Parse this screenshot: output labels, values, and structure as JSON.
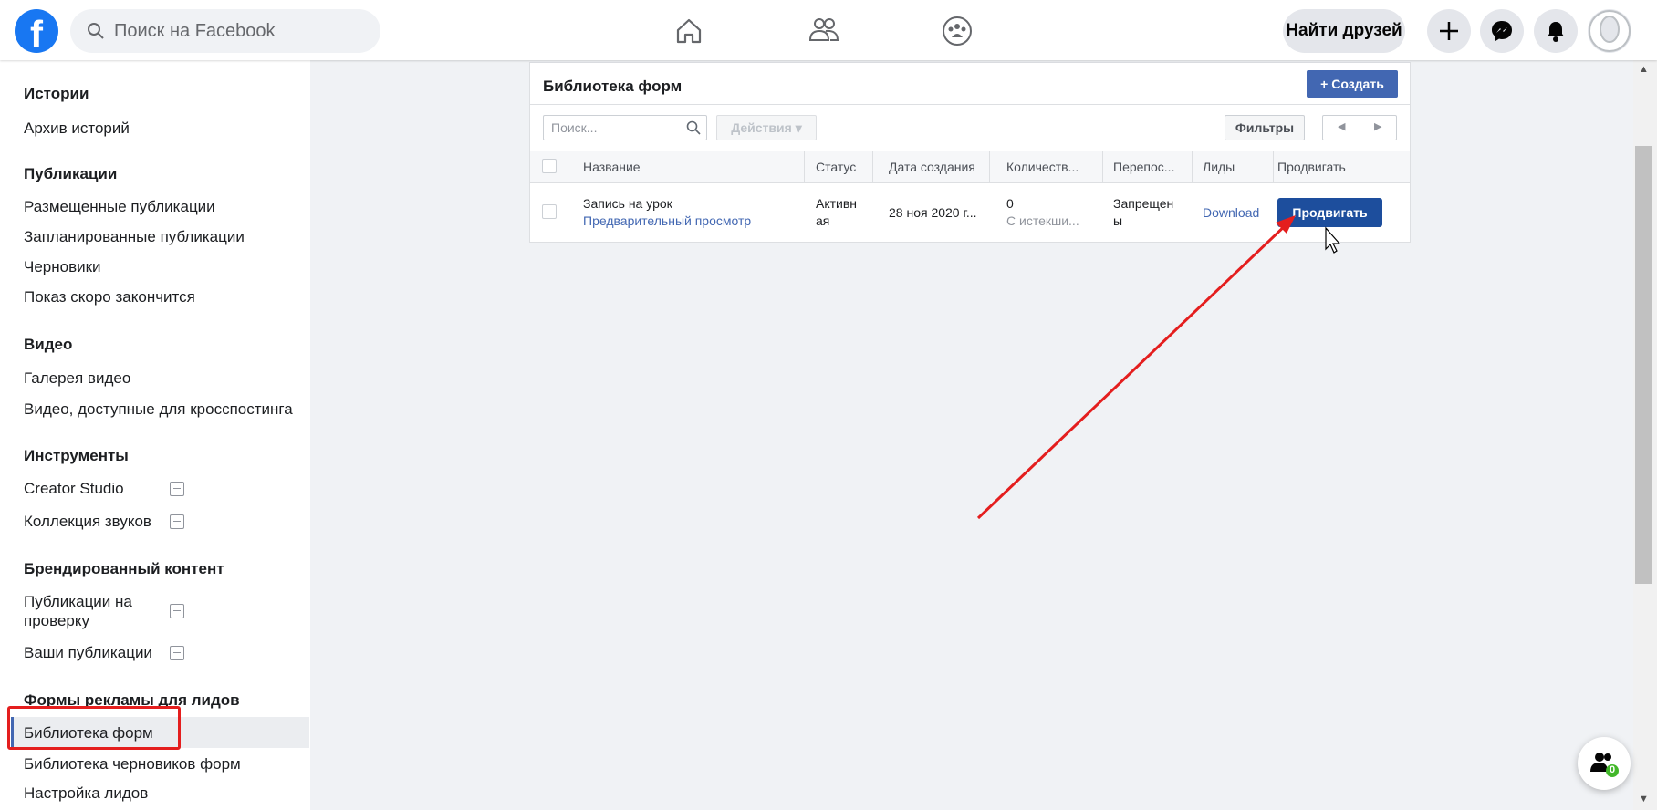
{
  "header": {
    "logo_letter": "f",
    "search_placeholder": "Поиск на Facebook",
    "find_friends_label": "Найти друзей",
    "nav_icons": [
      "home-icon",
      "friends-icon",
      "groups-icon"
    ],
    "action_icons": [
      "plus-icon",
      "messenger-icon",
      "notifications-icon",
      "avatar-icon"
    ]
  },
  "sidebar": {
    "sections": [
      {
        "title": "Истории",
        "items": [
          "Архив историй"
        ]
      },
      {
        "title": "Публикации",
        "items": [
          "Размещенные публикации",
          "Запланированные публикации",
          "Черновики",
          "Показ скоро закончится"
        ]
      },
      {
        "title": "Видео",
        "items": [
          "Галерея видео",
          "Видео, доступные для кросспостинга"
        ]
      },
      {
        "title": "Инструменты",
        "items": [
          "Creator Studio",
          "Коллекция звуков"
        ]
      },
      {
        "title": "Брендированный контент",
        "items": [
          "Публикации на проверку",
          "Ваши публикации"
        ]
      },
      {
        "title": "Формы рекламы для лидов",
        "items": [
          "Библиотека форм",
          "Библиотека черновиков форм",
          "Настройка лидов"
        ]
      }
    ],
    "active_item": "Библиотека форм"
  },
  "panel": {
    "title": "Библиотека форм",
    "create_label": "+ Создать",
    "search_placeholder": "Поиск...",
    "actions_label": "Действия ▾",
    "filters_label": "Фильтры",
    "columns": [
      "Название",
      "Статус",
      "Дата создания",
      "Количеств...",
      "Перепос...",
      "Лиды",
      "Продвигать"
    ],
    "rows": [
      {
        "name": "Запись на урок",
        "preview_link": "Предварительный просмотр",
        "status_line1": "Активн",
        "status_line2": "ая",
        "created": "28 ноя 2020 г...",
        "count": "0",
        "count_sub": "С истекши...",
        "repost_line1": "Запрещен",
        "repost_line2": "ы",
        "leads": "Download",
        "promote": "Продвигать"
      }
    ]
  },
  "colors": {
    "fb_blue": "#1877f2",
    "button_blue": "#4267b2",
    "promote_blue": "#1d4e9d",
    "annotation_red": "#e41e1e"
  },
  "fab": {
    "badge": "0"
  }
}
